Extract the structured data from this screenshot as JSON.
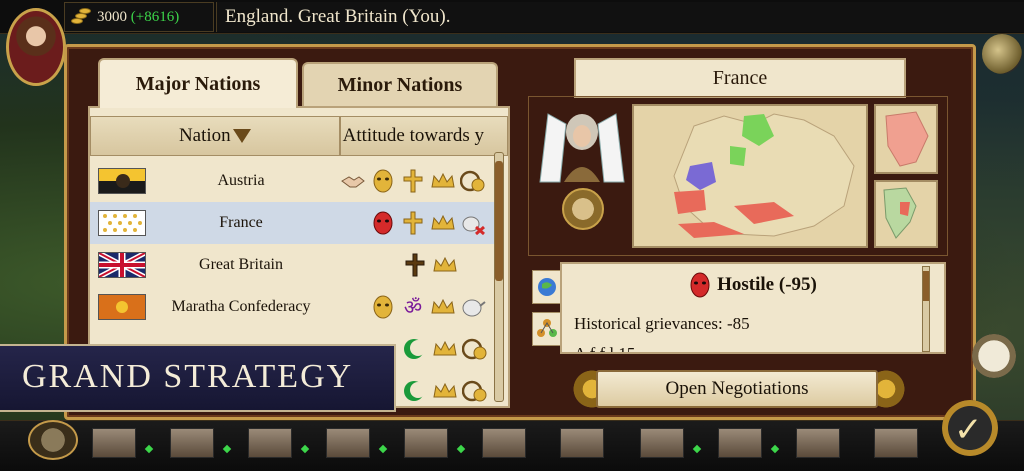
{
  "topbar": {
    "gold": "3000",
    "gold_delta": "(+8616)",
    "player_label": "England.   Great Britain (You)."
  },
  "tabs": {
    "major": "Major Nations",
    "minor": "Minor Nations"
  },
  "table": {
    "col_nation": "Nation",
    "col_attitude": "Attitude towards y",
    "rows": [
      {
        "name": "Austria",
        "flag": "austria-flag",
        "icons": [
          "handshake-icon",
          "mask-icon",
          "cross-icon",
          "crown-icon",
          "gold-cart-icon"
        ]
      },
      {
        "name": "France",
        "flag": "france-flag",
        "icons": [
          "red-mask-icon",
          "cross-icon",
          "crown-icon",
          "teapot-blocked-icon"
        ]
      },
      {
        "name": "Great Britain",
        "flag": "union-jack-flag",
        "icons": [
          "cross-icon",
          "crown-icon"
        ]
      },
      {
        "name": "Maratha Confederacy",
        "flag": "maratha-flag",
        "icons": [
          "mask-icon",
          "om-icon",
          "crown-icon",
          "teapot-icon"
        ]
      },
      {
        "name": "",
        "flag": "",
        "icons": [
          "crescent-icon",
          "crown-icon",
          "gold-cart-icon"
        ]
      },
      {
        "name": "",
        "flag": "",
        "icons": [
          "crescent-icon",
          "crown-icon",
          "gold-cart-icon"
        ]
      }
    ]
  },
  "detail": {
    "country": "France",
    "status": "Hostile (-95)",
    "grievances": "Historical grievances: -85",
    "cutoff_line": "A             f                     f    l   15",
    "negotiate_label": "Open Negotiations"
  },
  "banner": {
    "text": "GRAND STRATEGY"
  },
  "colors": {
    "accent_gold": "#c49a4a",
    "parchment": "#f0e6cc",
    "panel_bg": "#3b1a10",
    "selected_row": "#cfd9e6",
    "gold_delta": "#3cd64a"
  }
}
